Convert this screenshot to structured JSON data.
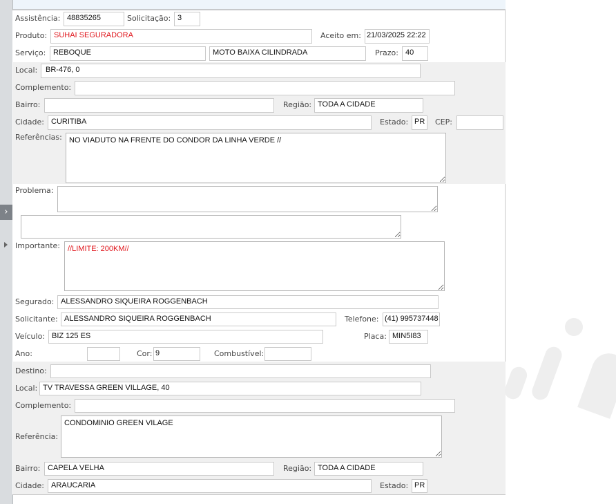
{
  "sidebar": {
    "expand_icon": "chevron-right-icon",
    "row_icon": "triangle-right-icon"
  },
  "colors": {
    "highlight_text": "#e0161c",
    "section_bg": "#f0f0f0"
  },
  "form": {
    "assistencia": {
      "label": "Assistência:",
      "value": "48835265"
    },
    "solicitacao": {
      "label": "Solicitação:",
      "value": "3"
    },
    "produto": {
      "label": "Produto:",
      "value": "SUHAI SEGURADORA"
    },
    "aceito_em": {
      "label": "Aceito em:",
      "value": "21/03/2025 22:22"
    },
    "servico": {
      "label": "Serviço:",
      "value": "REBOQUE",
      "value2": "MOTO BAIXA CILINDRADA"
    },
    "prazo": {
      "label": "Prazo:",
      "value": "40"
    },
    "local": {
      "label": "Local:",
      "value": "BR-476, 0"
    },
    "complemento": {
      "label": "Complemento:",
      "value": ""
    },
    "bairro": {
      "label": "Bairro:",
      "value": ""
    },
    "regiao": {
      "label": "Região:",
      "value": "TODA A CIDADE"
    },
    "cidade": {
      "label": "Cidade:",
      "value": "CURITIBA"
    },
    "estado": {
      "label": "Estado:",
      "value": "PR"
    },
    "cep": {
      "label": "CEP:",
      "value": ""
    },
    "referencias": {
      "label": "Referências:",
      "value": "NO VIADUTO NA FRENTE DO CONDOR DA LINHA VERDE //"
    },
    "problema": {
      "label": "Problema:",
      "value": "",
      "value2": ""
    },
    "importante": {
      "label": "Importante:",
      "value": "//LIMITE: 200KM//"
    },
    "segurado": {
      "label": "Segurado:",
      "value": "ALESSANDRO SIQUEIRA ROGGENBACH"
    },
    "solicitante": {
      "label": "Solicitante:",
      "value": "ALESSANDRO SIQUEIRA ROGGENBACH"
    },
    "telefone": {
      "label": "Telefone:",
      "value": "(41) 995737448"
    },
    "veiculo": {
      "label": "Veículo:",
      "value": "BIZ 125 ES"
    },
    "placa": {
      "label": "Placa:",
      "value": "MIN5I83"
    },
    "ano": {
      "label": "Ano:",
      "value": ""
    },
    "cor": {
      "label": "Cor:",
      "value": "9"
    },
    "combustivel": {
      "label": "Combustível:",
      "value": ""
    }
  },
  "destino": {
    "destino": {
      "label": "Destino:",
      "value": ""
    },
    "local": {
      "label": "Local:",
      "value": "TV TRAVESSA GREEN VILLAGE, 40"
    },
    "complemento": {
      "label": "Complemento:",
      "value": ""
    },
    "referencia": {
      "label": "Referência:",
      "value": "CONDOMINIO GREEN VILAGE"
    },
    "bairro": {
      "label": "Bairro:",
      "value": "CAPELA VELHA"
    },
    "regiao": {
      "label": "Região:",
      "value": "TODA A CIDADE"
    },
    "cidade": {
      "label": "Cidade:",
      "value": "ARAUCARIA"
    },
    "estado": {
      "label": "Estado:",
      "value": "PR"
    }
  }
}
